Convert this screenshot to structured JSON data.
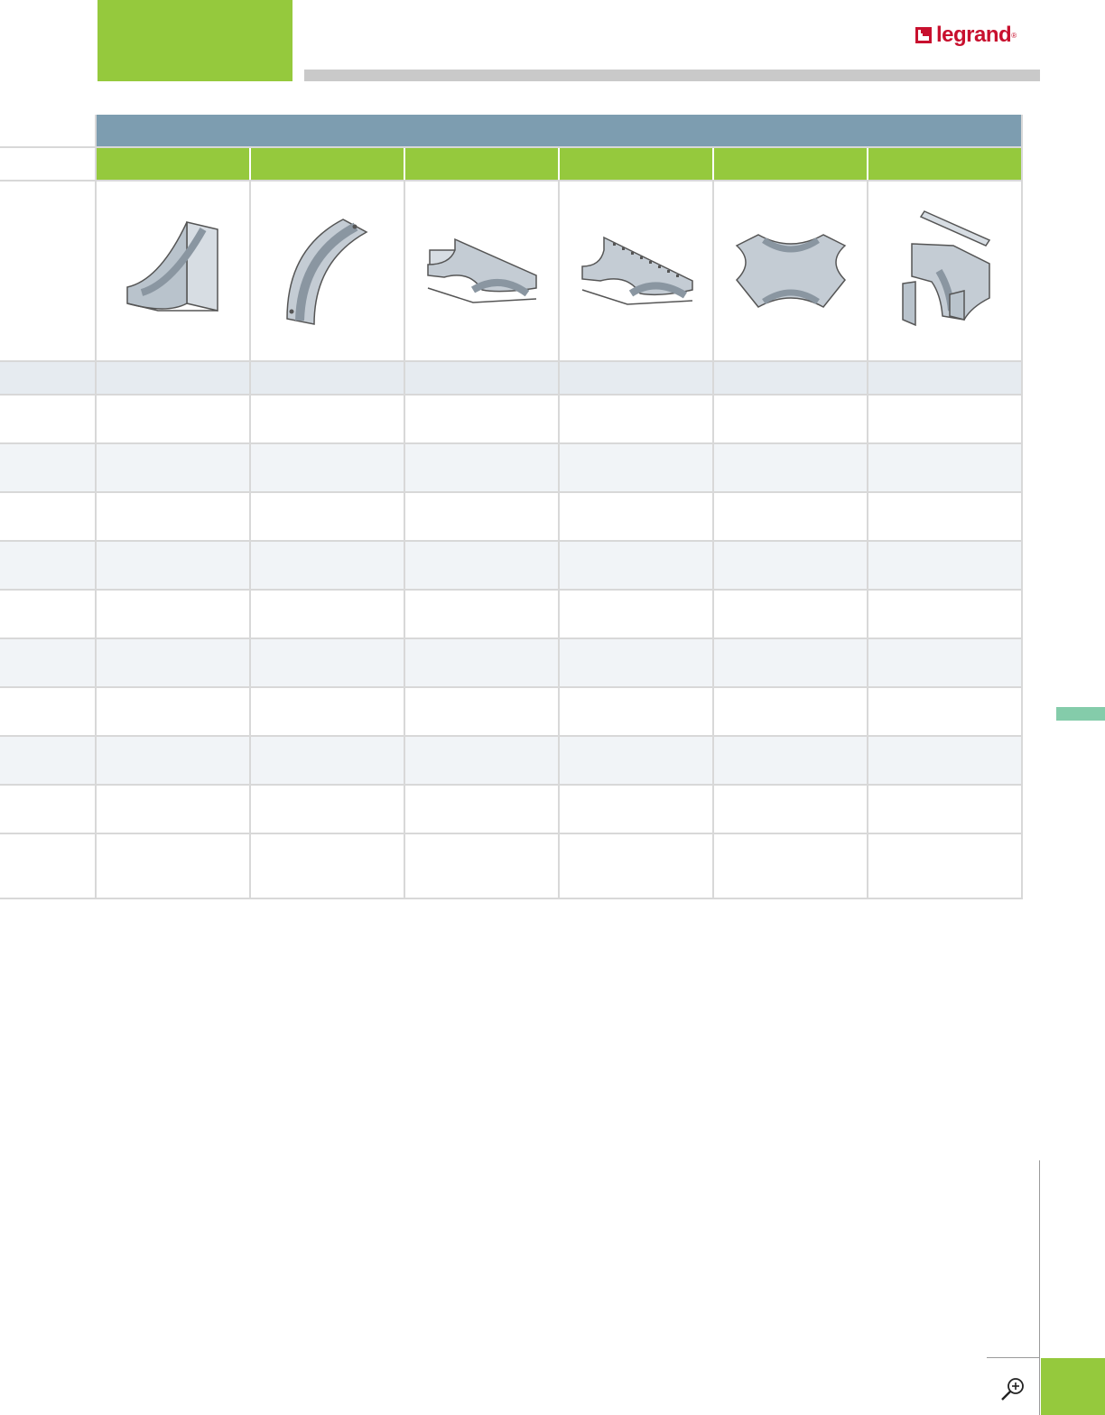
{
  "brand": {
    "logo_text": "legrand",
    "logo_mark": "®"
  },
  "colors": {
    "accent_green": "#95c93d",
    "header_blue": "#7d9db0",
    "rule_gray": "#c9c9c9",
    "brand_red": "#c8102e",
    "tab_teal": "#84ccaa"
  },
  "products": [
    {
      "icon": "vertical-inside-bend-icon"
    },
    {
      "icon": "vertical-outside-bend-icon"
    },
    {
      "icon": "tee-fitting-icon"
    },
    {
      "icon": "perforated-tee-fitting-icon"
    },
    {
      "icon": "cross-fitting-icon"
    },
    {
      "icon": "exploded-tee-with-cover-icon"
    }
  ],
  "icons": {
    "zoom": "zoom-in-icon"
  }
}
